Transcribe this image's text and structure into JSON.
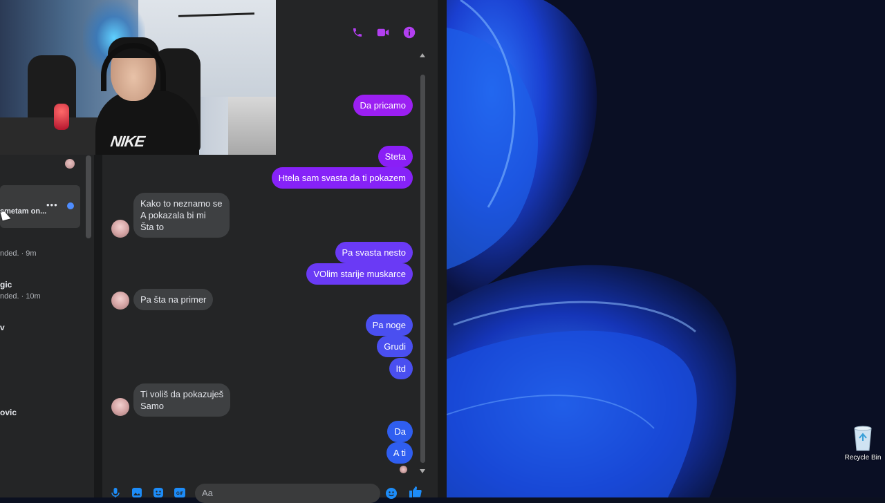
{
  "sidebar": {
    "active_preview": "smetam on...",
    "items": [
      {
        "name": "",
        "meta": "nded. · 9m"
      },
      {
        "name": "gic",
        "meta": "nded. · 10m"
      },
      {
        "name": "v",
        "meta": ""
      },
      {
        "name": "ovic",
        "meta": ""
      }
    ]
  },
  "header": {
    "icons": [
      "phone-icon",
      "video-icon",
      "info-icon"
    ],
    "accent": "#b23ff0"
  },
  "messages": [
    {
      "dir": "out",
      "text": "Da pricamo",
      "color": "#9b1ff2"
    },
    {
      "dir": "out",
      "text": "Steta",
      "color": "#8a1ff6"
    },
    {
      "dir": "out",
      "text": "Htela sam svasta da ti pokazem",
      "color": "#8622f8"
    },
    {
      "dir": "in",
      "lines": [
        "Kako to neznamo se",
        "A pokazala bi mi",
        "Šta to"
      ]
    },
    {
      "dir": "out",
      "text": "Pa svasta nesto",
      "color": "#6a3af5"
    },
    {
      "dir": "out",
      "text": "VOlim starije muskarce",
      "color": "#6a3af5"
    },
    {
      "dir": "in",
      "lines": [
        "Pa šta na primer"
      ]
    },
    {
      "dir": "out",
      "text": "Pa noge",
      "color": "#4a4ff0"
    },
    {
      "dir": "out",
      "text": "Grudi",
      "color": "#4a4ff0"
    },
    {
      "dir": "out",
      "text": "Itd",
      "color": "#4a4ff0"
    },
    {
      "dir": "in",
      "lines": [
        "Ti voliš da pokazuješ",
        "Samo"
      ]
    },
    {
      "dir": "out",
      "text": "Da",
      "color": "#2f5ef0"
    },
    {
      "dir": "out",
      "text": "A ti",
      "color": "#2f5ef0"
    }
  ],
  "composer": {
    "placeholder": "Aa",
    "icons": [
      "microphone-icon",
      "image-icon",
      "sticker-icon",
      "gif-icon",
      "emoji-icon",
      "like-icon"
    ]
  },
  "desktop": {
    "recycle_bin_label": "Recycle Bin"
  },
  "webcam": {
    "shirt_logo": "NIKE"
  }
}
